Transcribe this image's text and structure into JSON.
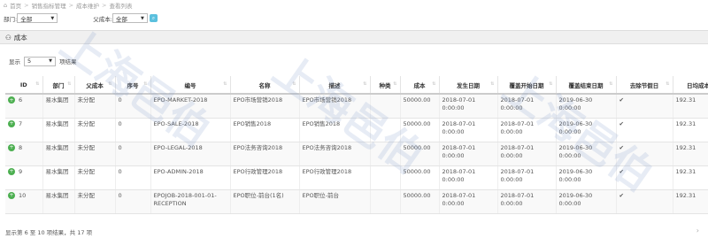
{
  "breadcrumb": [
    "首页",
    "销售指标管理",
    "成本维护",
    "查看列表"
  ],
  "filters": {
    "dept_label": "部门:",
    "dept_value": "全部",
    "parent_cost_label": "父成本:",
    "parent_cost_value": "全部"
  },
  "panel_title": "成本",
  "length_control": {
    "prefix": "显示",
    "value": "5",
    "suffix": "项结果"
  },
  "table": {
    "headers": [
      "ID",
      "部门",
      "父成本",
      "序号",
      "编号",
      "名称",
      "描述",
      "种类",
      "成本",
      "发生日期",
      "覆盖开始日期",
      "覆盖结束日期",
      "去除节假日",
      "日均成本"
    ],
    "rows": [
      [
        "6",
        "易水集团",
        "未分配",
        "0",
        "EPO-MARKET-2018",
        "EPO市场营销2018",
        "EPO市场营销2018",
        "",
        "50000.00",
        "2018-07-01 0:00:00",
        "2018-07-01 0:00:00",
        "2019-06-30 0:00:00",
        "✔",
        "192.31"
      ],
      [
        "7",
        "易水集团",
        "未分配",
        "0",
        "EPO-SALE-2018",
        "EPO销售2018",
        "EPO销售2018",
        "",
        "50000.00",
        "2018-07-01 0:00:00",
        "2018-07-01 0:00:00",
        "2019-06-30 0:00:00",
        "✔",
        "192.31"
      ],
      [
        "8",
        "易水集团",
        "未分配",
        "0",
        "EPO-LEGAL-2018",
        "EPO法务咨询2018",
        "EPO法务咨询2018",
        "",
        "50000.00",
        "2018-07-01 0:00:00",
        "2018-07-01 0:00:00",
        "2019-06-30 0:00:00",
        "✔",
        "192.31"
      ],
      [
        "9",
        "易水集团",
        "未分配",
        "0",
        "EPO-ADMIN-2018",
        "EPO行政管理2018",
        "EPO行政管理2018",
        "",
        "50000.00",
        "2018-07-01 0:00:00",
        "2018-07-01 0:00:00",
        "2019-06-30 0:00:00",
        "✔",
        "192.31"
      ],
      [
        "10",
        "易水集团",
        "未分配",
        "0",
        "EPOJOB-2018-001-01-RECEPTION",
        "EPO职位-前台(1名)",
        "EPO职位-前台",
        "",
        "50000.00",
        "2018-07-01 0:00:00",
        "2018-07-01 0:00:00",
        "2019-06-30 0:00:00",
        "✔",
        "192.31"
      ]
    ]
  },
  "footer_info": "显示第 6 至 10 项结果，共 17 项",
  "watermark": "上海邑伯",
  "colors": {
    "accent": "#5bc0de",
    "row_icon": "#4caf50"
  }
}
